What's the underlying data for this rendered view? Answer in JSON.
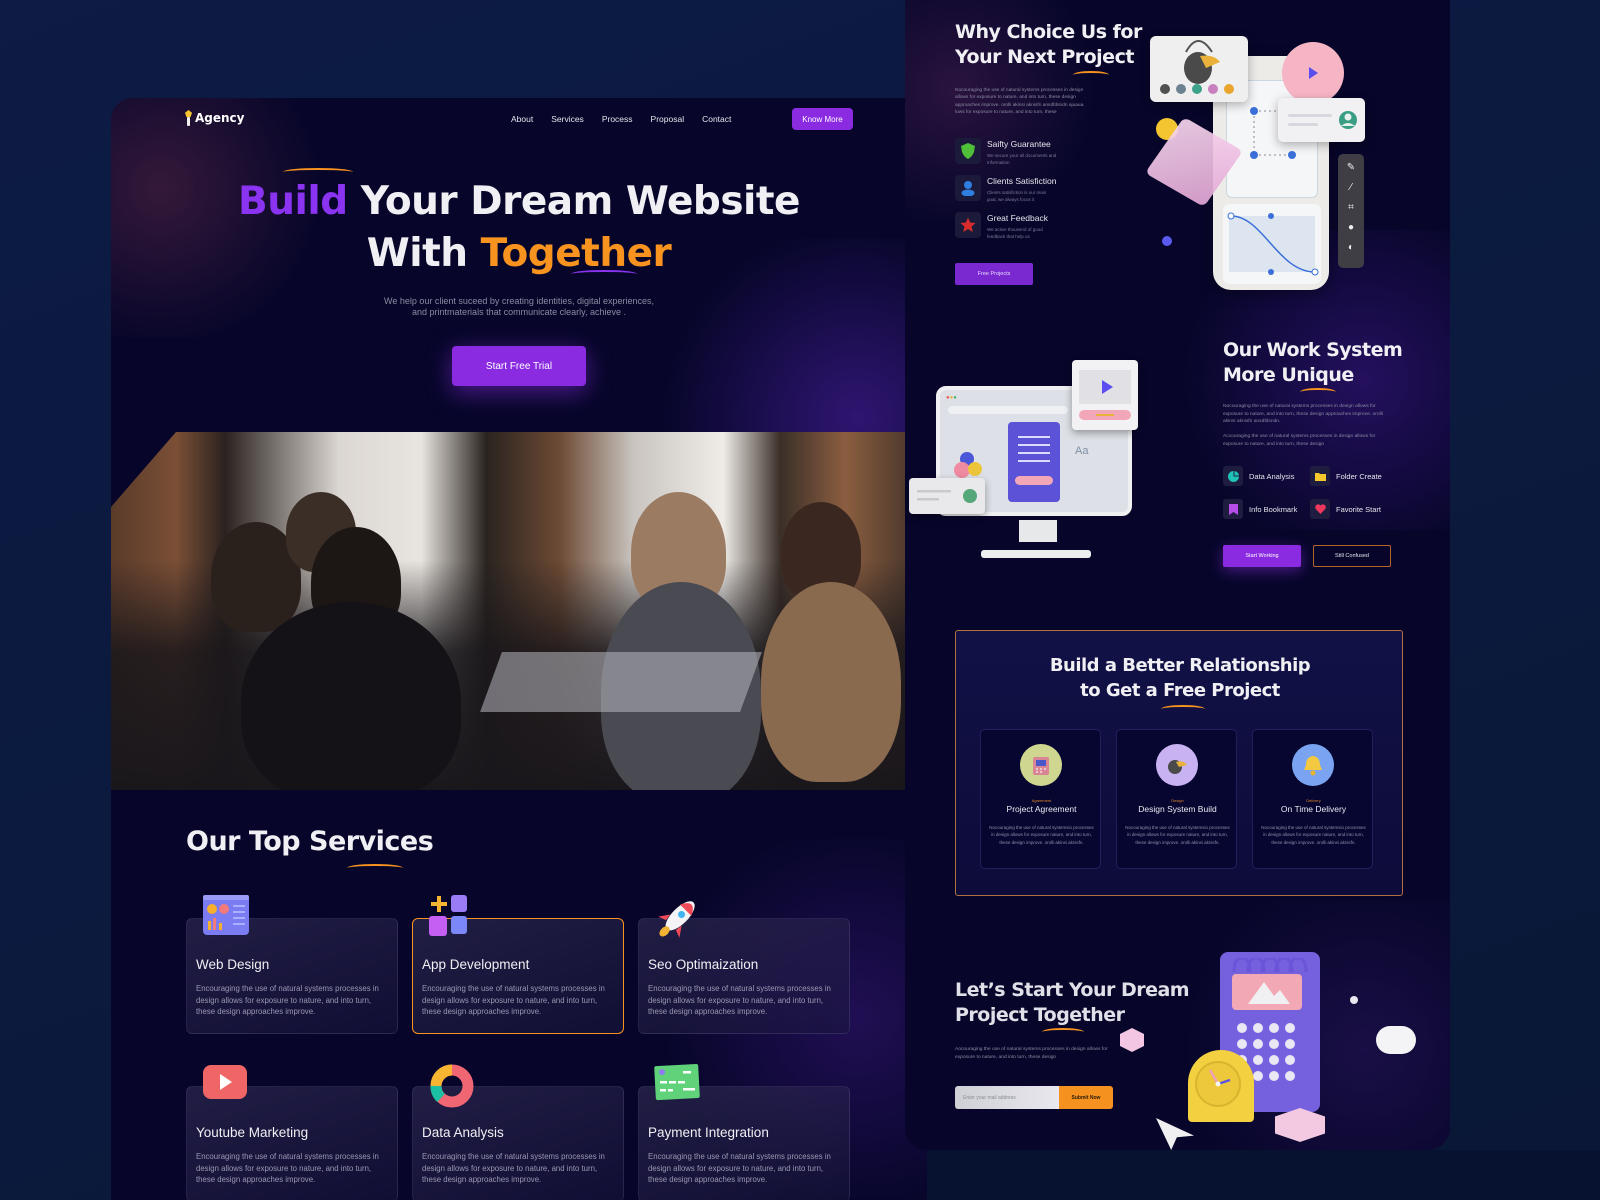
{
  "left_page": {
    "nav": {
      "logo": "Agency",
      "links": [
        "About",
        "Services",
        "Process",
        "Proposal",
        "Contact"
      ],
      "cta": "Know More"
    },
    "hero": {
      "title_line1_highlight": "Build",
      "title_line1_rest": " Your Dream Website",
      "title_line2_start": "With ",
      "title_line2_highlight": "Together",
      "subtitle_line1": "We help our client suceed by creating identities, digital experiences,",
      "subtitle_line2": "and printmaterials that communicate clearly, achieve  .",
      "cta": "Start Free Trial"
    },
    "services": {
      "title": "Our Top Services",
      "items": [
        {
          "title": "Web Design",
          "icon": "web-design-icon",
          "desc": "Encouraging the use of natural systems processes in design allows for exposure to nature, and into turn, these design approaches improve."
        },
        {
          "title": "App Development",
          "icon": "app-grid-icon",
          "desc": "Encouraging the use of natural systems processes in design allows for exposure to nature, and into turn, these design approaches improve."
        },
        {
          "title": "Seo Optimaization",
          "icon": "rocket-icon",
          "desc": "Encouraging the use of natural systems processes in design allows for exposure to nature, and into turn, these design approaches improve."
        },
        {
          "title": "Youtube Marketing",
          "icon": "play-icon",
          "desc": "Encouraging the use of natural systems processes in design allows for exposure to nature, and into turn, these design approaches improve."
        },
        {
          "title": "Data Analysis",
          "icon": "donut-chart-icon",
          "desc": "Encouraging the use of natural systems processes in design allows for exposure to nature, and into turn, these design approaches improve."
        },
        {
          "title": "Payment Integration",
          "icon": "credit-card-icon",
          "desc": "Encouraging the use of natural systems processes in design allows for exposure to nature, and into turn, these design approaches improve."
        }
      ]
    }
  },
  "right_page": {
    "why": {
      "title_line1": "Why Choice Us for",
      "title_line2": "Your Next Project",
      "desc": "Nocouraging the use of natural systems processes in design allows for exposure to nature, and into turn, these design approaches improve. orolli akinsi aknisfn ansdfdsndn ajuaua. lows for exposure to nature, and into turn, these",
      "features": [
        {
          "title": "Saifty Guarantee",
          "icon": "shield-icon",
          "desc": "We secure your all documents and Information"
        },
        {
          "title": "Clients Satisfiction",
          "icon": "user-icon",
          "desc": "Clients satisfiction is our main goal, we always focus it"
        },
        {
          "title": "Great Feedback",
          "icon": "star-icon",
          "desc": "We active thousend of good feedback that help us"
        }
      ],
      "cta": "Free Projects"
    },
    "work": {
      "title_line1": "Our Work System",
      "title_line2": "More Unique",
      "desc1": "Nocouraging the use of natural systems processes in design allows for exposure to nature, and into turn, these design approaches improve. orolli akinsi aknisfn ansdfdsndn.",
      "desc2": "Accouraging the use of natural systems processes in design allows for exposure to nature, and into turn, these design",
      "features": [
        {
          "label": "Data Analysis",
          "icon": "pie-chart-icon"
        },
        {
          "label": "Folder Create",
          "icon": "folder-icon"
        },
        {
          "label": "Info Bookmark",
          "icon": "bookmark-icon"
        },
        {
          "label": "Favorite Start",
          "icon": "heart-icon"
        }
      ],
      "cta_primary": "Start Working",
      "cta_secondary": "Still Confused"
    },
    "relationship": {
      "title_line1": "Build a Better Relationship",
      "title_line2": "to Get a Free Project",
      "cards": [
        {
          "tag": "Agreement",
          "title": "Project Agreement",
          "icon": "calendar-icon",
          "desc": "Nocouraging the use of natural systemsio processes in design allows for exposure nature, and into turn, these design improve. orolli akinsi aknisfn."
        },
        {
          "tag": "Design",
          "title": "Design System Build",
          "icon": "paint-bucket-icon",
          "desc": "Nocouraging the use of natural systemsio processes in design allows for exposure nature, and into turn, these design improve. orolli akinsi aknisfn."
        },
        {
          "tag": "Delivery",
          "title": "On Time Delivery",
          "icon": "bell-icon",
          "desc": "Nocouraging the use of natural systemsio processes in design allows for exposure nature, and into turn, these design improve. orolli akinsi aknisfn."
        }
      ]
    },
    "cta": {
      "title_line1": "Let’s Start Your Dream",
      "title_line2": "Project Together",
      "desc": "Aocouraging the use of natural systems processes in design allows for exposure to nature, and into turn, these design",
      "email_placeholder": "Enter your mail address",
      "submit": "Submit Now"
    }
  },
  "colors": {
    "accent_purple": "#8a2be2",
    "accent_orange": "#f7931e",
    "page_bg": "#07062a",
    "outer_bg": "#0d1b45"
  }
}
